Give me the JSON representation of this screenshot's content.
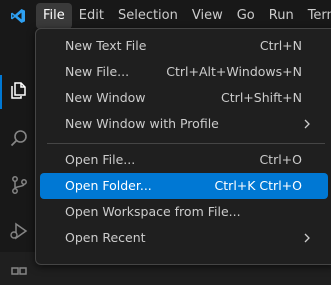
{
  "menubar": {
    "items": [
      "File",
      "Edit",
      "Selection",
      "View",
      "Go",
      "Run",
      "Termi"
    ],
    "active": "File"
  },
  "activity_bar": {
    "icons": [
      "explorer-icon",
      "search-icon",
      "source-control-icon",
      "run-debug-icon",
      "extensions-icon"
    ]
  },
  "file_menu": {
    "items": [
      {
        "label": "New Text File",
        "shortcut": "Ctrl+N"
      },
      {
        "label": "New File...",
        "shortcut": "Ctrl+Alt+Windows+N"
      },
      {
        "label": "New Window",
        "shortcut": "Ctrl+Shift+N"
      },
      {
        "label": "New Window with Profile",
        "shortcut": ""
      },
      {
        "label": "Open File...",
        "shortcut": "Ctrl+O"
      },
      {
        "label": "Open Folder...",
        "shortcut": "Ctrl+K Ctrl+O"
      },
      {
        "label": "Open Workspace from File...",
        "shortcut": ""
      },
      {
        "label": "Open Recent",
        "shortcut": ""
      }
    ]
  },
  "colors": {
    "accent": "#0078d4",
    "background": "#1f1f1f",
    "titlebar": "#181818",
    "text": "#cccccc"
  }
}
